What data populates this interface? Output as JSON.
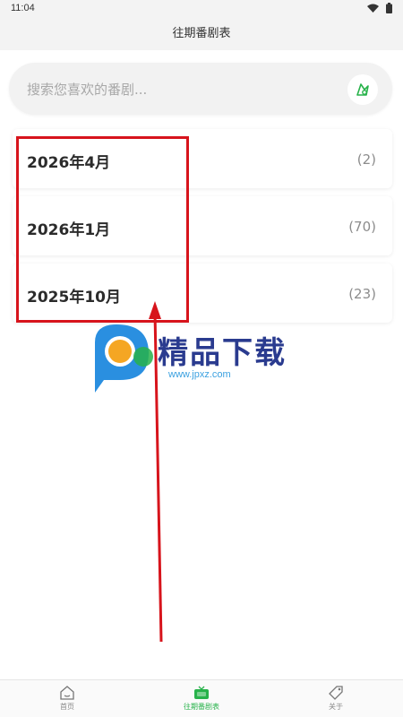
{
  "status_bar": {
    "time": "11:04"
  },
  "header": {
    "title": "往期番剧表"
  },
  "search": {
    "placeholder": "搜索您喜欢的番剧..."
  },
  "seasons": [
    {
      "label": "2026年4月",
      "count": "(2)"
    },
    {
      "label": "2026年1月",
      "count": "(70)"
    },
    {
      "label": "2025年10月",
      "count": "(23)"
    }
  ],
  "watermark": {
    "text": "精品下载",
    "url": "www.jpxz.com"
  },
  "bottom_nav": [
    {
      "label": "首页",
      "icon": "home-icon",
      "active": false
    },
    {
      "label": "往期番剧表",
      "icon": "tv-icon",
      "active": true
    },
    {
      "label": "关于",
      "icon": "tag-icon",
      "active": false
    }
  ],
  "colors": {
    "accent": "#27b24a",
    "annotation": "#d7141c",
    "page_bg": "#ffffff",
    "header_bg": "#f3f3f3"
  }
}
